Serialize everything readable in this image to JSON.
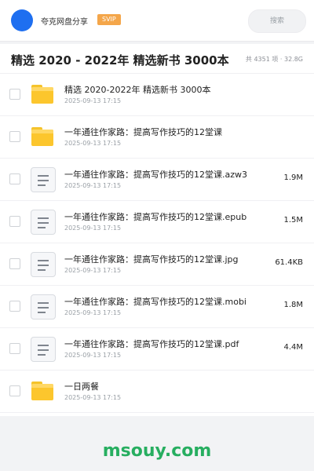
{
  "header": {
    "brand": "夸克网盘分享",
    "badge": "SVIP",
    "search_placeholder": "搜索"
  },
  "folder": {
    "title": "精选 2020 - 2022年 精选新书 3000本",
    "meta": "共 4351 项 · 32.8G"
  },
  "items": [
    {
      "name": "精选 2020-2022年 精选新书 3000本",
      "date": "2025-09-13 17:15",
      "size": "",
      "icon": "folder-icon"
    },
    {
      "name": "一年通往作家路：提高写作技巧的12堂课",
      "date": "2025-09-13 17:15",
      "size": "",
      "icon": "folder-icon"
    },
    {
      "name": "一年通往作家路：提高写作技巧的12堂课.azw3",
      "date": "2025-09-13 17:15",
      "size": "1.9M",
      "icon": "document-icon"
    },
    {
      "name": "一年通往作家路：提高写作技巧的12堂课.epub",
      "date": "2025-09-13 17:15",
      "size": "1.5M",
      "icon": "document-icon"
    },
    {
      "name": "一年通往作家路：提高写作技巧的12堂课.jpg",
      "date": "2025-09-13 17:15",
      "size": "61.4KB",
      "icon": "document-icon"
    },
    {
      "name": "一年通往作家路：提高写作技巧的12堂课.mobi",
      "date": "2025-09-13 17:15",
      "size": "1.8M",
      "icon": "document-icon"
    },
    {
      "name": "一年通往作家路：提高写作技巧的12堂课.pdf",
      "date": "2025-09-13 17:15",
      "size": "4.4M",
      "icon": "document-icon"
    },
    {
      "name": "一日两餐",
      "date": "2025-09-13 17:15",
      "size": "",
      "icon": "folder-icon"
    }
  ],
  "footer": {
    "watermark": "msouy.com"
  },
  "colors": {
    "accent": "#1e6ff0",
    "badge": "#f4a64a",
    "folder": "#fcc62d",
    "watermark": "#27ae60"
  }
}
